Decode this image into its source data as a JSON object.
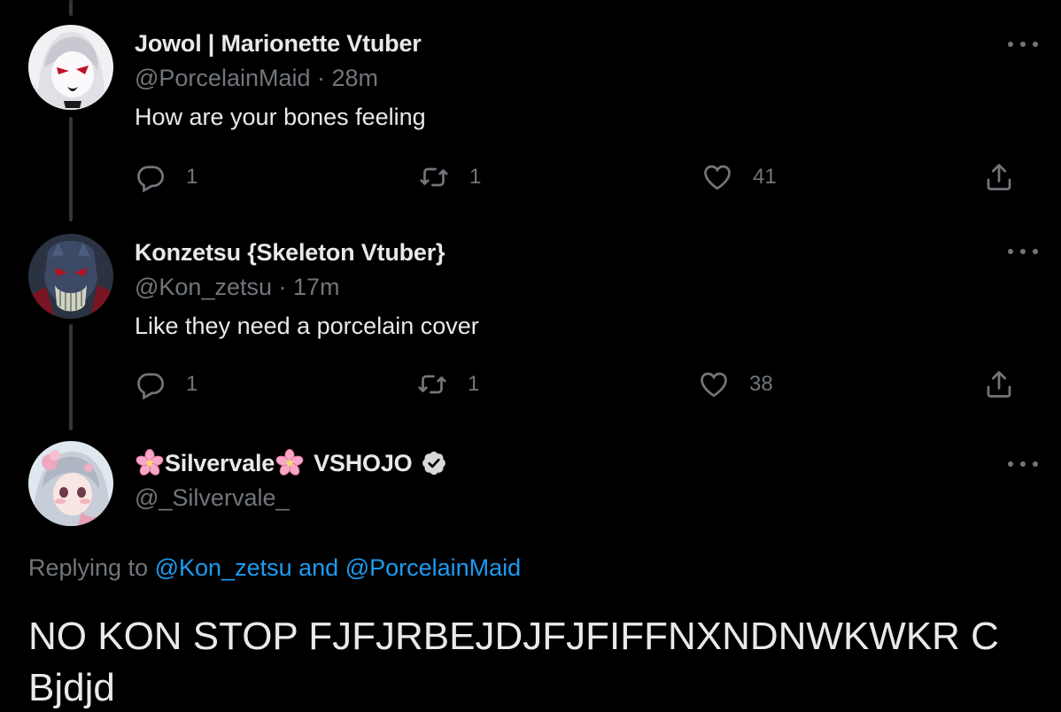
{
  "tweets": [
    {
      "display_name": "Jowol | Marionette Vtuber",
      "handle": "@PorcelainMaid",
      "time": "28m",
      "text": "How are your bones feeling",
      "replies": "1",
      "retweets": "1",
      "likes": "41",
      "avatar_icon": "porcelain-maid-avatar"
    },
    {
      "display_name": "Konzetsu {Skeleton Vtuber}",
      "handle": "@Kon_zetsu",
      "time": "17m",
      "text": "Like they need a porcelain cover",
      "replies": "1",
      "retweets": "1",
      "likes": "38",
      "avatar_icon": "skeleton-avatar"
    }
  ],
  "main_tweet": {
    "display_name_part1": "Silvervale",
    "display_name_part2": "VSHOJO",
    "handle": "@_Silvervale_",
    "replying_prefix": "Replying to",
    "replying_user1": "@Kon_zetsu",
    "replying_and": "and",
    "replying_user2": "@PorcelainMaid",
    "text": "NO KON STOP FJFJRBEJDJFJFIFFNXNDNWKWKR CBjdjd",
    "verified_icon": "verified-badge-icon",
    "flower_icon": "cherry-blossom-icon"
  },
  "colors": {
    "background": "#000000",
    "primary_text": "#e7e9ea",
    "secondary_text": "#71767b",
    "link": "#1d9bf0",
    "thread_line": "#333639"
  },
  "icons": {
    "reply": "reply-icon",
    "retweet": "retweet-icon",
    "like": "heart-icon",
    "share": "share-icon",
    "more": "more-options-icon"
  }
}
